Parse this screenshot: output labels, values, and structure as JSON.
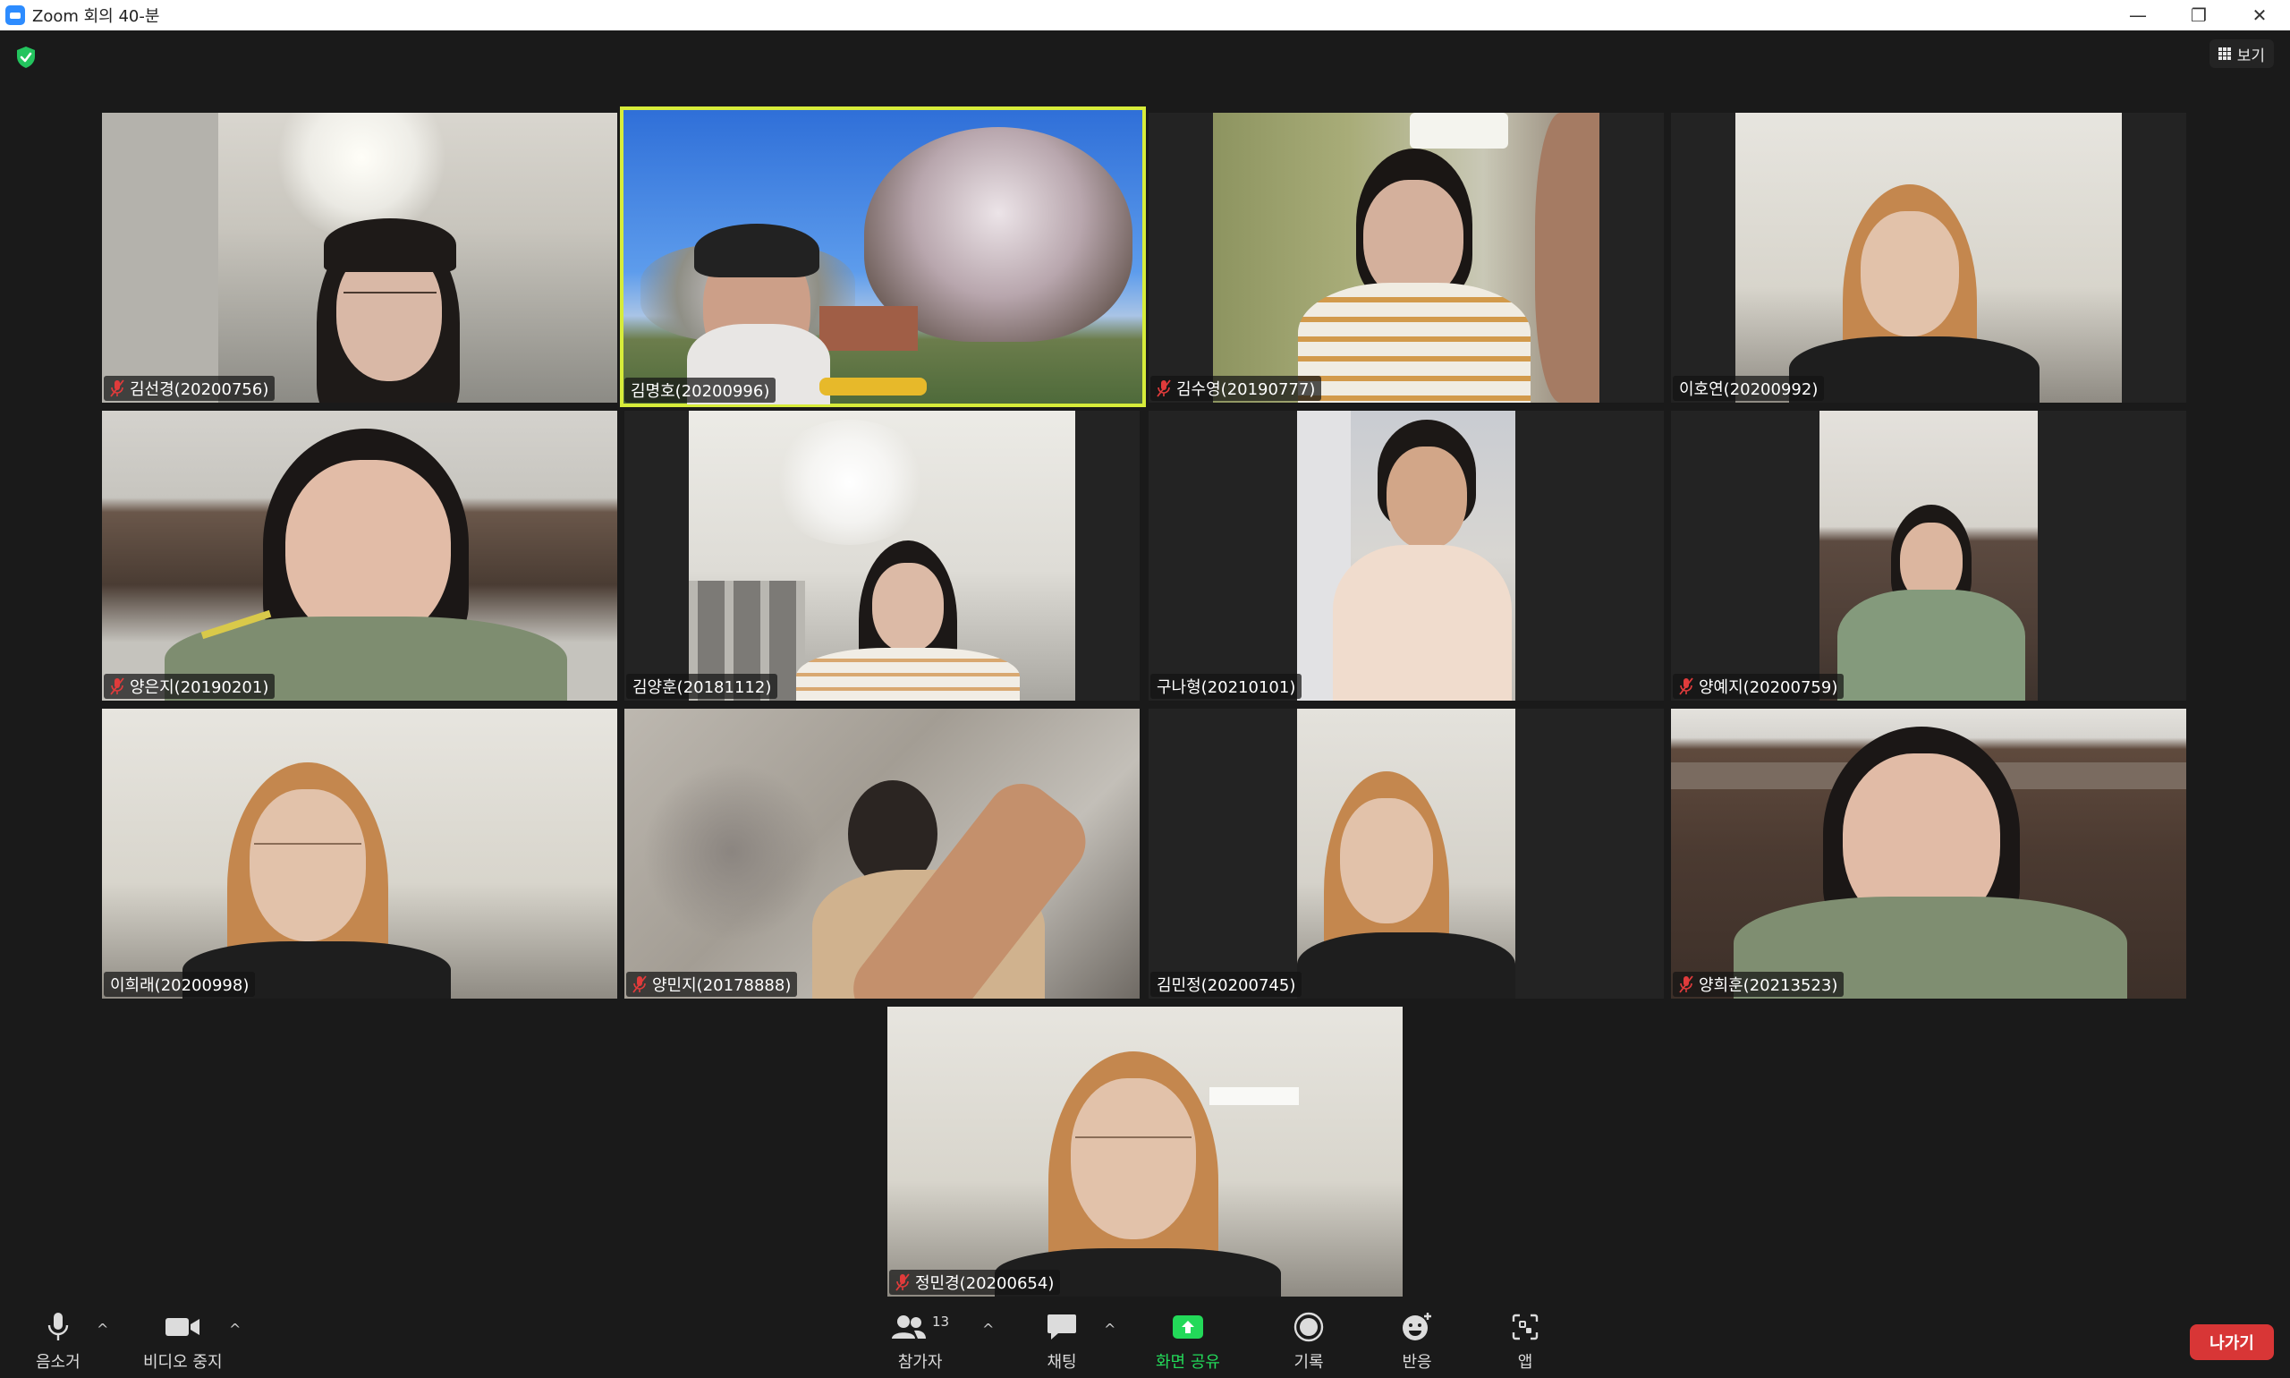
{
  "window": {
    "title": "Zoom 회의 40-분",
    "controls": [
      "—",
      "❐",
      "✕"
    ]
  },
  "top": {
    "view_label": "보기"
  },
  "participants": [
    {
      "name": "김선경(20200756)",
      "muted": true,
      "active": false
    },
    {
      "name": "김명호(20200996)",
      "muted": false,
      "active": true
    },
    {
      "name": "김수영(20190777)",
      "muted": true,
      "active": false
    },
    {
      "name": "이호연(20200992)",
      "muted": false,
      "active": false
    },
    {
      "name": "양은지(20190201)",
      "muted": true,
      "active": false
    },
    {
      "name": "김양훈(20181112)",
      "muted": false,
      "active": false
    },
    {
      "name": "구나형(20210101)",
      "muted": false,
      "active": false
    },
    {
      "name": "양예지(20200759)",
      "muted": true,
      "active": false
    },
    {
      "name": "이희래(20200998)",
      "muted": false,
      "active": false
    },
    {
      "name": "양민지(20178888)",
      "muted": true,
      "active": false
    },
    {
      "name": "김민정(20200745)",
      "muted": false,
      "active": false
    },
    {
      "name": "양희훈(20213523)",
      "muted": true,
      "active": false
    },
    {
      "name": "정민경(20200654)",
      "muted": true,
      "active": false
    }
  ],
  "toolbar": {
    "mute_label": "음소거",
    "video_label": "비디오 중지",
    "participants_label": "참가자",
    "participants_count": "13",
    "chat_label": "채팅",
    "share_label": "화면 공유",
    "record_label": "기록",
    "reactions_label": "반응",
    "apps_label": "앱",
    "leave_label": "나가기"
  },
  "colors": {
    "background": "#1a1a1a",
    "active_speaker": "#d7ec3a",
    "share_green": "#23d959",
    "leave_red": "#d83636",
    "zoom_blue": "#2d8cff"
  }
}
